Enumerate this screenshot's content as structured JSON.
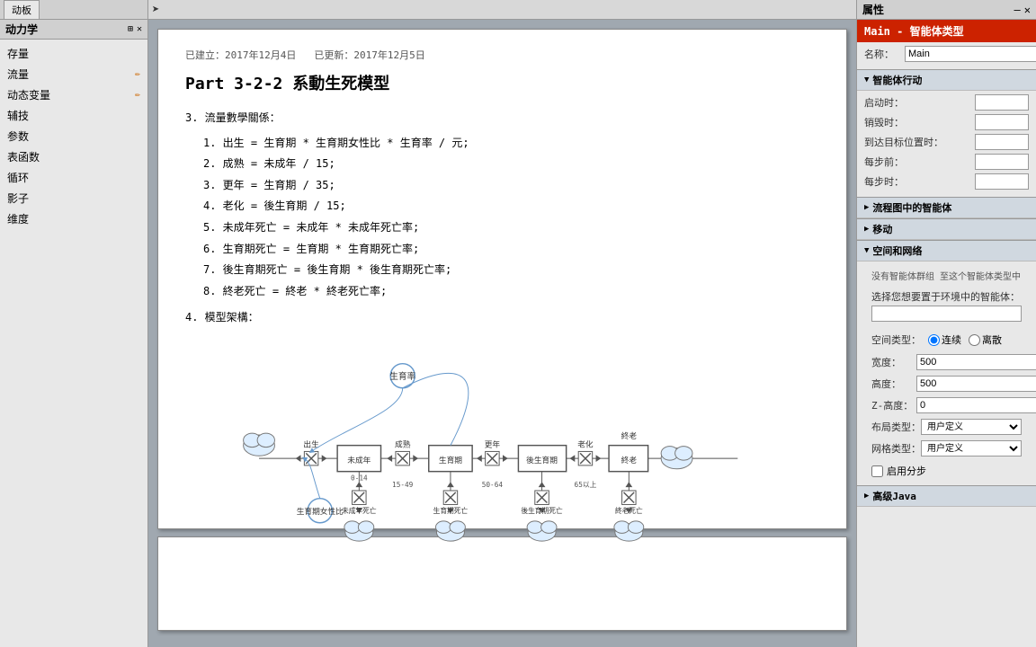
{
  "app": {
    "title": "动力学",
    "tab_label": "动板"
  },
  "sidebar": {
    "header": "动力学",
    "items": [
      {
        "label": "存量",
        "has_edit": false
      },
      {
        "label": "流量",
        "has_edit": true
      },
      {
        "label": "动态变量",
        "has_edit": true
      },
      {
        "label": "辅技",
        "has_edit": false
      },
      {
        "label": "参数",
        "has_edit": false
      },
      {
        "label": "表函数",
        "has_edit": false
      },
      {
        "label": "循环",
        "has_edit": false
      },
      {
        "label": "影子",
        "has_edit": false
      },
      {
        "label": "维度",
        "has_edit": false
      }
    ]
  },
  "document": {
    "meta_created": "已建立：2017年12月4日",
    "meta_updated": "已更新：2017年12月5日",
    "title": "Part 3-2-2 系動生死模型",
    "section3_label": "3.   流量數學關係：",
    "equations": [
      "1.   出生 = 生育期 * 生育期女性比 * 生育率 / 元;",
      "2.   成熟 = 未成年 / 15;",
      "3.   更年 = 生育期 / 35;",
      "4.   老化 = 後生育期 / 15;",
      "5.   未成年死亡 = 未成年 * 未成年死亡率;",
      "6.   生育期死亡 = 生育期 * 生育期死亡率;",
      "7.   後生育期死亡 = 後生育期 * 後生育期死亡率;",
      "8.   終老死亡 = 終老 * 終老死亡率;"
    ],
    "section4_label": "4.   模型架構："
  },
  "diagram": {
    "nodes": [
      {
        "id": "birth_rate",
        "label": "生育率",
        "type": "circle"
      },
      {
        "id": "minor",
        "label": "未成年",
        "type": "stock"
      },
      {
        "id": "fertile",
        "label": "生育期",
        "type": "stock"
      },
      {
        "id": "post_fertile",
        "label": "後生育期",
        "type": "stock"
      },
      {
        "id": "elder",
        "label": "終老",
        "type": "stock"
      },
      {
        "id": "birth",
        "label": "出生",
        "type": "flow_label"
      },
      {
        "id": "mature",
        "label": "成熟",
        "type": "flow_label"
      },
      {
        "id": "menopause",
        "label": "更年",
        "type": "flow_label"
      },
      {
        "id": "aging",
        "label": "老化",
        "type": "flow_label"
      },
      {
        "id": "minor_death",
        "label": "未成年死亡",
        "type": "death"
      },
      {
        "id": "fertile_death",
        "label": "生育期死亡",
        "type": "death"
      },
      {
        "id": "post_death",
        "label": "後生育期死亡",
        "type": "death"
      },
      {
        "id": "elder_death",
        "label": "終老死亡",
        "type": "death"
      },
      {
        "id": "female_ratio",
        "label": "生育期女性比",
        "type": "circle_small"
      },
      {
        "id": "age_0_14",
        "label": "0-14",
        "type": "age_label"
      },
      {
        "id": "age_15_49",
        "label": "15-49",
        "type": "age_label"
      },
      {
        "id": "age_50_64",
        "label": "50-64",
        "type": "age_label"
      },
      {
        "id": "age_65plus",
        "label": "65以上",
        "type": "age_label"
      }
    ]
  },
  "right_panel": {
    "title": "属性",
    "main_title": "Main - 智能体类型",
    "name_label": "名称：",
    "name_value": "Main",
    "agent_behavior_label": "智能体行动",
    "startup_label": "启动时：",
    "startup_value": "",
    "destroy_label": "销毁时：",
    "destroy_value": "",
    "arrive_label": "到达目标位置时：",
    "arrive_value": "",
    "step_before_label": "每步前：",
    "step_before_value": "",
    "step_after_label": "每步时：",
    "step_after_value": "",
    "flow_agent_label": "流程图中的智能体",
    "move_label": "移动",
    "space_network_label": "空间和网络",
    "no_agent_text": "没有智能体群组 至这个智能体类型中",
    "choose_agent_label": "选择您想要置于环境中的智能体：",
    "choose_agent_value": "",
    "space_type_label": "空间类型：",
    "space_continuous": "连续",
    "space_discrete": "离散",
    "space_width_label": "宽度：",
    "space_width_value": "500",
    "space_height_label": "高度：",
    "space_height_value": "500",
    "space_z_label": "Z-高度：",
    "space_z_value": "0",
    "layout_label": "布局类型：",
    "layout_value": "用户定义",
    "grid_label": "网格类型：",
    "grid_value": "用户定义",
    "use_steps_label": "启用分步",
    "advanced_java_label": "高级Java"
  }
}
